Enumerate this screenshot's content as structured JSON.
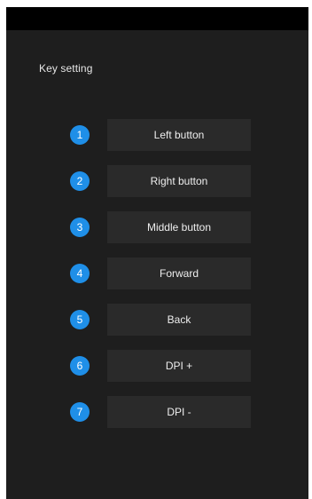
{
  "section": {
    "title": "Key setting"
  },
  "keys": [
    {
      "number": "1",
      "label": "Left button"
    },
    {
      "number": "2",
      "label": "Right button"
    },
    {
      "number": "3",
      "label": "Middle button"
    },
    {
      "number": "4",
      "label": "Forward"
    },
    {
      "number": "5",
      "label": "Back"
    },
    {
      "number": "6",
      "label": "DPI +"
    },
    {
      "number": "7",
      "label": "DPI -"
    }
  ],
  "colors": {
    "background": "#1e1e1e",
    "titlebar": "#000000",
    "button_bg": "#2a2a2a",
    "badge": "#1f8fe8",
    "text": "#eeeeee"
  }
}
